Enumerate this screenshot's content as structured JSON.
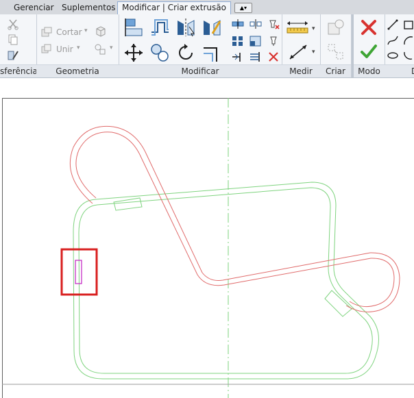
{
  "tabs": [
    {
      "label": "Gerenciar",
      "active": false
    },
    {
      "label": "Suplementos",
      "active": false
    },
    {
      "label": "Modificar | Criar extrusão",
      "active": true
    }
  ],
  "quick_access_icon": "dropdown-arrow-icon",
  "panels": {
    "transferencia": {
      "label": "sferência"
    },
    "geometria": {
      "label": "Geometria",
      "cortar_label": "Cortar",
      "unir_label": "Unir"
    },
    "modificar": {
      "label": "Modificar"
    },
    "medir": {
      "label": "Medir"
    },
    "criar": {
      "label": "Criar"
    },
    "modo": {
      "label": "Modo"
    },
    "desenhar": {
      "label": "D"
    }
  },
  "colors": {
    "accent_tab_border": "#8faad1",
    "cancel_red": "#d8322f",
    "finish_green": "#3fa535",
    "sketch_red": "#e06a6a",
    "sketch_green": "#7ed37e",
    "highlight_red": "#d81f1f",
    "selected_magenta": "#c21fc2"
  }
}
